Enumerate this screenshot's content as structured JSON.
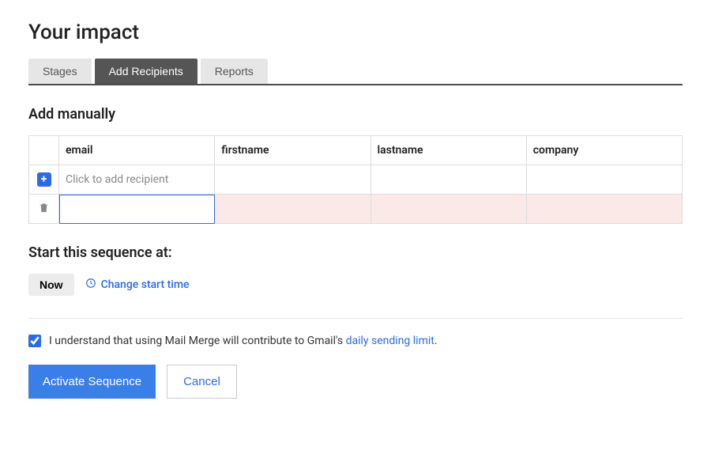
{
  "header": {
    "title": "Your impact"
  },
  "tabs": [
    {
      "label": "Stages",
      "active": false
    },
    {
      "label": "Add Recipients",
      "active": true
    },
    {
      "label": "Reports",
      "active": false
    }
  ],
  "addManually": {
    "heading": "Add manually",
    "columns": [
      "email",
      "firstname",
      "lastname",
      "company"
    ],
    "addRow": {
      "placeholder": "Click to add recipient",
      "iconName": "plus-icon"
    },
    "rows": [
      {
        "email": "",
        "firstname": "",
        "lastname": "",
        "company": "",
        "editing": true,
        "error": true,
        "iconName": "trash-icon"
      }
    ]
  },
  "startSequence": {
    "heading": "Start this sequence at:",
    "nowLabel": "Now",
    "changeLabel": "Change start time"
  },
  "consent": {
    "checked": true,
    "prefix": "I understand that using Mail Merge will contribute to Gmail's ",
    "linkText": "daily sending limit",
    "suffix": "."
  },
  "buttons": {
    "primary": "Activate Sequence",
    "secondary": "Cancel"
  }
}
